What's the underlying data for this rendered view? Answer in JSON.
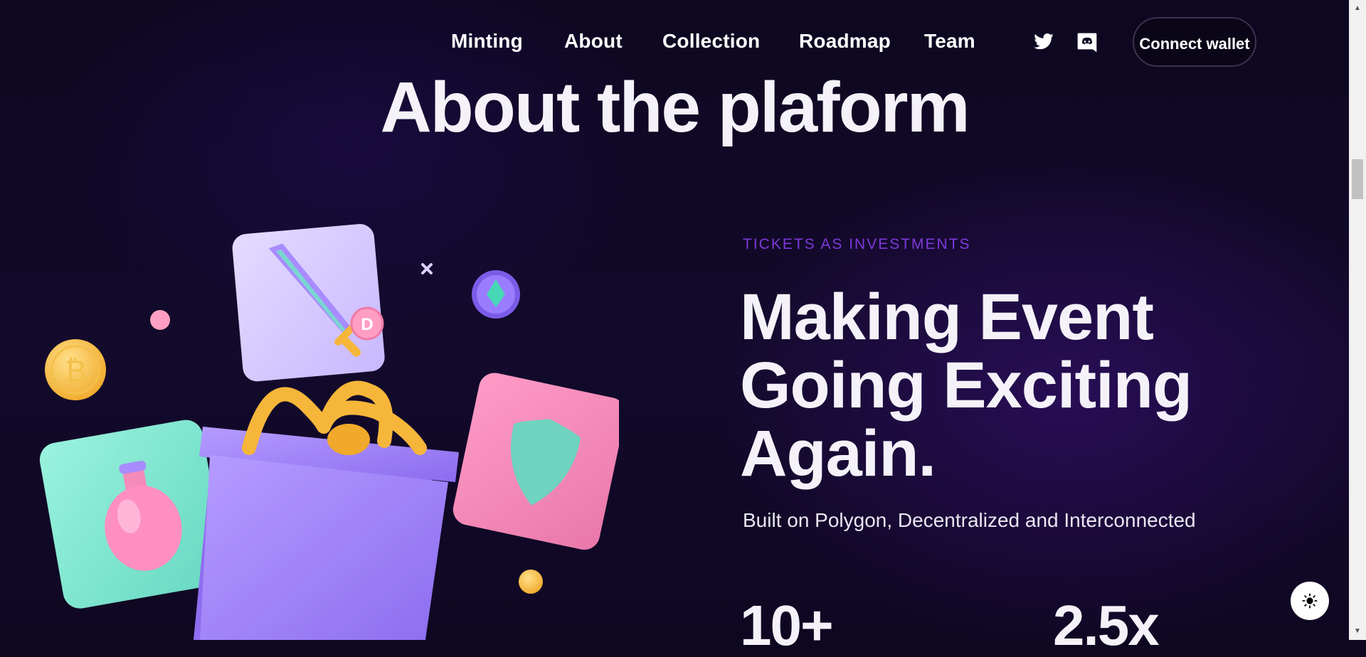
{
  "nav": {
    "links": [
      "Minting",
      "About",
      "Collection",
      "Roadmap",
      "Team"
    ],
    "twitter_icon": "twitter-icon",
    "discord_icon": "discord-icon",
    "connect_label": "Connect wallet"
  },
  "section": {
    "title": "About the plaform",
    "eyebrow": "TICKETS AS INVESTMENTS",
    "headline": [
      "Making Event",
      "Going Exciting",
      "Again."
    ],
    "subline": "Built on Polygon, Decentralized and Interconnected",
    "stats": [
      "10+",
      "2.5x"
    ]
  },
  "ui": {
    "theme_toggle_icon": "sun-icon"
  },
  "colors": {
    "background": "#0e0720",
    "accent": "#7d3ad8",
    "text": "#f4f2f8"
  }
}
